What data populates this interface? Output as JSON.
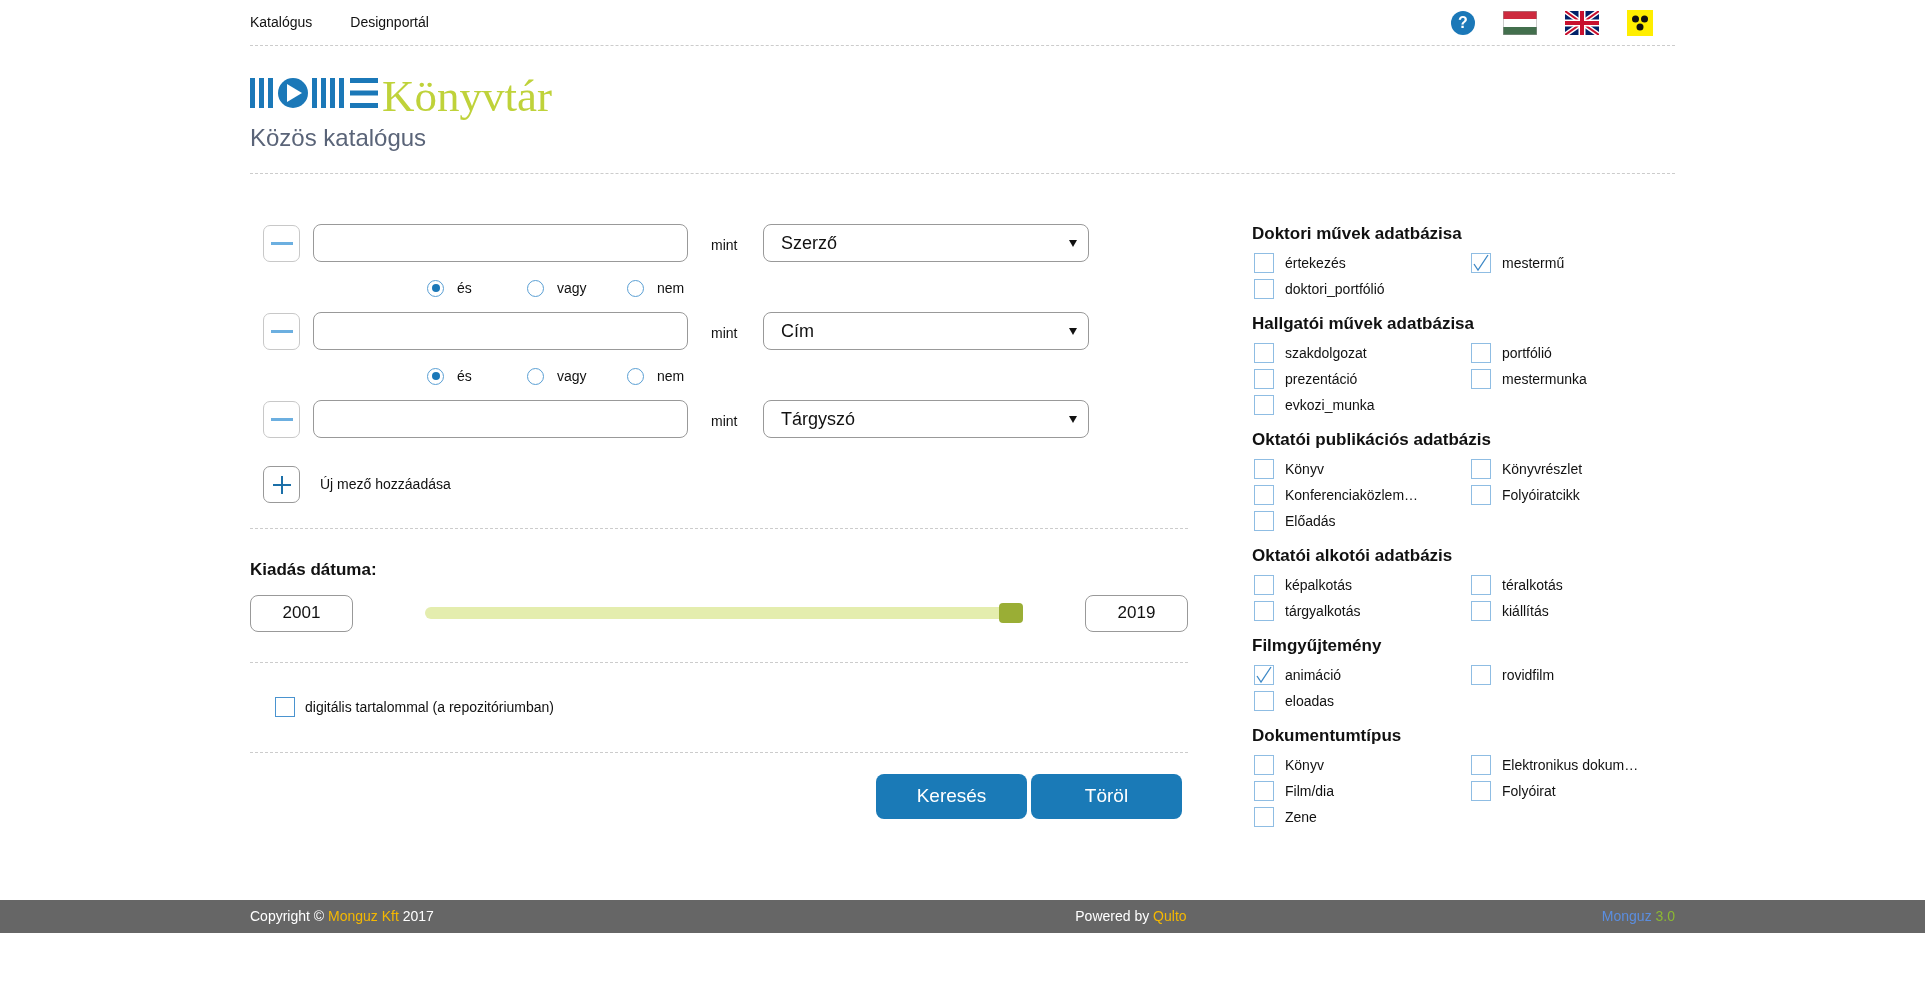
{
  "top_nav": {
    "links": [
      "Katalógus",
      "Designportál"
    ],
    "help": "?"
  },
  "header": {
    "logo_text": "Könyvtár",
    "subtitle": "Közös katalógus"
  },
  "search_rows": [
    {
      "connector": "mint",
      "field": "Szerző",
      "operators": [
        {
          "label": "és",
          "selected": true
        },
        {
          "label": "vagy",
          "selected": false
        },
        {
          "label": "nem",
          "selected": false
        }
      ]
    },
    {
      "connector": "mint",
      "field": "Cím",
      "operators": [
        {
          "label": "és",
          "selected": true
        },
        {
          "label": "vagy",
          "selected": false
        },
        {
          "label": "nem",
          "selected": false
        }
      ]
    },
    {
      "connector": "mint",
      "field": "Tárgyszó"
    }
  ],
  "add_field": {
    "label": "Új mező hozzáadása"
  },
  "date": {
    "label": "Kiadás dátuma:",
    "from": "2001",
    "to": "2019",
    "level": 0.98
  },
  "digital": {
    "label": "digitális tartalommal (a repozitóriumban)",
    "checked": false
  },
  "buttons": [
    "Keresés",
    "Töröl"
  ],
  "filters": [
    {
      "title": "Doktori művek adatbázisa",
      "items": [
        {
          "label": "értekezés",
          "checked": false
        },
        {
          "label": "mestermű",
          "checked": true
        },
        {
          "label": "doktori_portfólió",
          "checked": false
        }
      ]
    },
    {
      "title": "Hallgatói művek adatbázisa",
      "items": [
        {
          "label": "szakdolgozat",
          "checked": false
        },
        {
          "label": "portfólió",
          "checked": false
        },
        {
          "label": "prezentáció",
          "checked": false
        },
        {
          "label": "mestermunka",
          "checked": false
        },
        {
          "label": "evkozi_munka",
          "checked": false
        }
      ]
    },
    {
      "title": "Oktatói publikációs adatbázis",
      "items": [
        {
          "label": "Könyv",
          "checked": false
        },
        {
          "label": "Könyvrészlet",
          "checked": false
        },
        {
          "label": "Konferenciaközlem…",
          "checked": false
        },
        {
          "label": "Folyóiratcikk",
          "checked": false
        },
        {
          "label": "Előadás",
          "checked": false
        }
      ]
    },
    {
      "title": "Oktatói alkotói adatbázis",
      "items": [
        {
          "label": "képalkotás",
          "checked": false
        },
        {
          "label": "téralkotás",
          "checked": false
        },
        {
          "label": "tárgyalkotás",
          "checked": false
        },
        {
          "label": "kiállítás",
          "checked": false
        }
      ]
    },
    {
      "title": "Filmgyűjtemény",
      "items": [
        {
          "label": "animáció",
          "checked": true
        },
        {
          "label": "rovidfilm",
          "checked": false
        },
        {
          "label": "eloadas",
          "checked": false
        }
      ]
    },
    {
      "title": "Dokumentumtípus",
      "items": [
        {
          "label": "Könyv",
          "checked": false
        },
        {
          "label": "Elektronikus dokum…",
          "checked": false
        },
        {
          "label": "Film/dia",
          "checked": false
        },
        {
          "label": "Folyóirat",
          "checked": false
        },
        {
          "label": "Zene",
          "checked": false
        }
      ]
    }
  ],
  "footer": {
    "copyright": "Copyright ©",
    "company": "Monguz Kft",
    "year": "2017",
    "powered": "Powered by",
    "powered_name": "Qulto",
    "product": "Monguz",
    "version": "3.0"
  }
}
